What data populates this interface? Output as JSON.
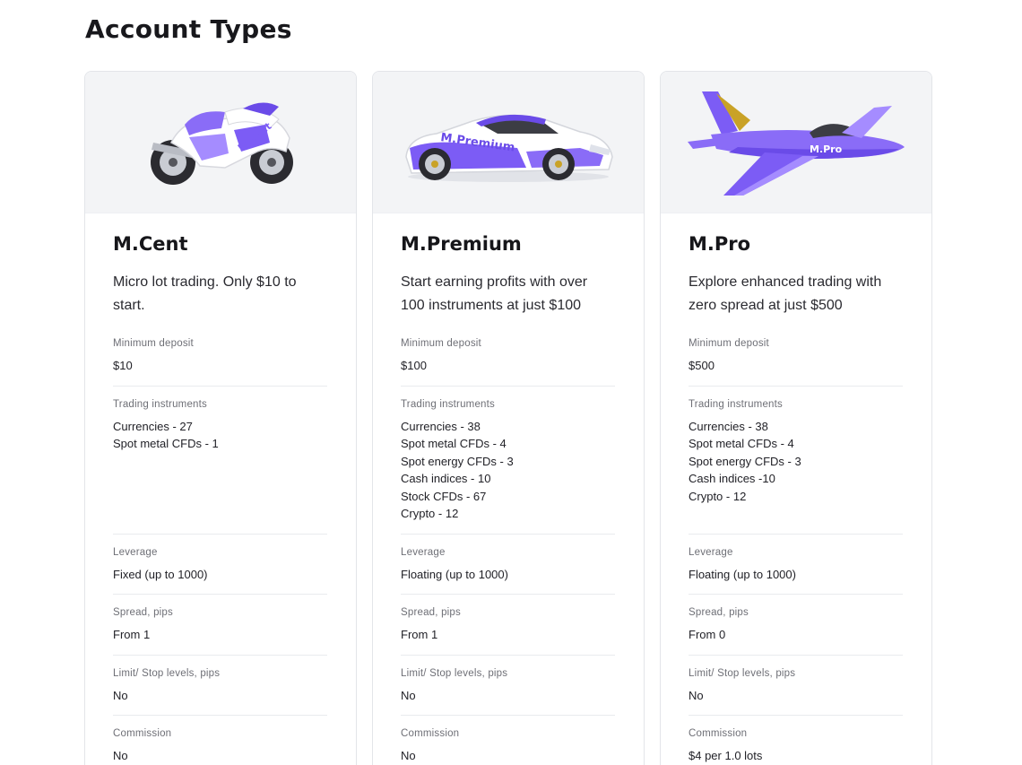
{
  "page": {
    "title": "Account Types"
  },
  "colors": {
    "accent": "#7c5cf5",
    "accent_light": "#a58cff",
    "media_bg": "#f3f4f6",
    "gold": "#c9a227"
  },
  "cards": [
    {
      "image_icon": "motorcycle-icon",
      "image_label": "M.Cent",
      "title": "M.Cent",
      "description": "Micro lot trading. Only $10 to start.",
      "specs": {
        "min_deposit_label": "Minimum deposit",
        "min_deposit": "$10",
        "instruments_label": "Trading instruments",
        "instruments": [
          "Currencies - 27",
          "Spot metal CFDs - 1"
        ],
        "leverage_label": "Leverage",
        "leverage": "Fixed (up to 1000)",
        "spread_label": "Spread, pips",
        "spread": "From 1",
        "limit_label": "Limit/ Stop levels, pips",
        "limit": "No",
        "commission_label": "Commission",
        "commission": "No"
      }
    },
    {
      "image_icon": "sports-car-icon",
      "image_label": "M.Premium",
      "title": "M.Premium",
      "description": "Start earning profits with over 100 instruments at just $100",
      "specs": {
        "min_deposit_label": "Minimum deposit",
        "min_deposit": "$100",
        "instruments_label": "Trading instruments",
        "instruments": [
          "Currencies - 38",
          "Spot metal CFDs - 4",
          "Spot energy CFDs - 3",
          "Cash indices - 10",
          "Stock CFDs - 67",
          "Crypto - 12"
        ],
        "leverage_label": "Leverage",
        "leverage": "Floating (up to 1000)",
        "spread_label": "Spread, pips",
        "spread": "From 1",
        "limit_label": "Limit/ Stop levels, pips",
        "limit": "No",
        "commission_label": "Commission",
        "commission": "No"
      }
    },
    {
      "image_icon": "jet-plane-icon",
      "image_label": "M.Pro",
      "title": "M.Pro",
      "description": "Explore enhanced trading with zero spread at just $500",
      "specs": {
        "min_deposit_label": "Minimum deposit",
        "min_deposit": "$500",
        "instruments_label": "Trading instruments",
        "instruments": [
          "Currencies - 38",
          "Spot metal CFDs - 4",
          "Spot energy CFDs - 3",
          "Cash indices -10",
          "Crypto - 12"
        ],
        "leverage_label": "Leverage",
        "leverage": "Floating (up to 1000)",
        "spread_label": "Spread, pips",
        "spread": "From 0",
        "limit_label": "Limit/ Stop levels, pips",
        "limit": "No",
        "commission_label": "Commission",
        "commission": "$4 per 1.0 lots"
      }
    }
  ]
}
